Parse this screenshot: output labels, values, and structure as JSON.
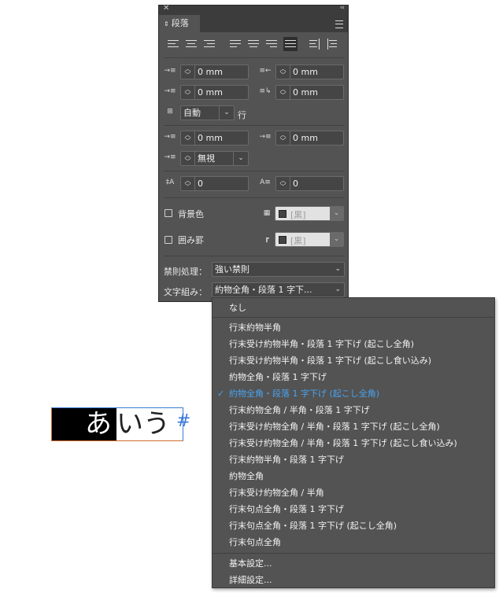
{
  "panel": {
    "close": "✕",
    "collapse": "‹‹",
    "tab_label": "段落",
    "tab_arrows": "⇕",
    "fields": {
      "indent_left": "0 mm",
      "indent_right": "0 mm",
      "first_line": "0 mm",
      "last_line": "0 mm",
      "space_before": "0 mm",
      "space_after": "0 mm",
      "grid_align": "自動",
      "grid_unit": "行",
      "drop_lines": "無視",
      "dropcap_lines": "0",
      "dropcap_chars": "0"
    },
    "shading_label": "背景色",
    "border_label": "囲み罫",
    "color_value": "[黒]",
    "kinsoku_label": "禁則処理：",
    "kinsoku_value": "強い禁則",
    "mojikumi_label": "文字組み：",
    "mojikumi_value": "約物全角・段落 1 字下..."
  },
  "dropdown": {
    "items_top": [
      "なし"
    ],
    "items": [
      "行末約物半角",
      "行末受け約物半角・段落 1 字下げ (起こし全角)",
      "行末受け約物半角・段落 1 字下げ (起こし食い込み)",
      "約物全角・段落 1 字下げ",
      "約物全角・段落 1 字下げ (起こし全角)",
      "行末約物全角 / 半角・段落 1 字下げ",
      "行末受け約物全角 / 半角・段落 1 字下げ (起こし全角)",
      "行末受け約物全角 / 半角・段落 1 字下げ (起こし食い込み)",
      "行末約物半角・段落 1 字下げ",
      "約物全角",
      "行末受け約物全角 / 半角",
      "行末句点全角・段落 1 字下げ",
      "行末句点全角・段落 1 字下げ (起こし全角)",
      "行末句点全角"
    ],
    "selected_index": 4,
    "items_bottom": [
      "基本設定...",
      "詳細設定..."
    ]
  },
  "canvas": {
    "char1": "あ",
    "char2": "いう",
    "end_mark": "#"
  }
}
